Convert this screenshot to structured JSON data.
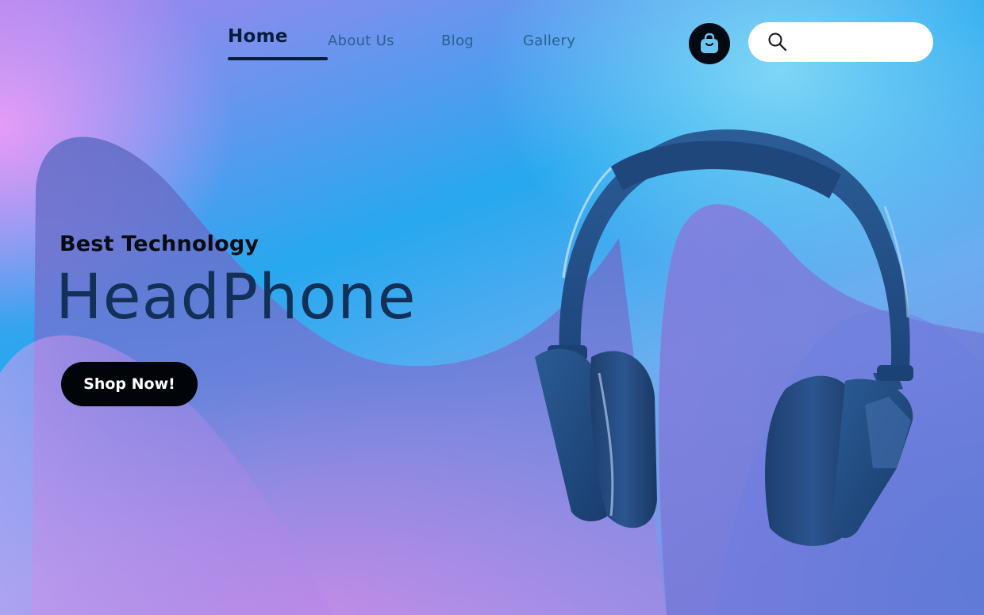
{
  "nav": {
    "items": [
      {
        "label": "Home",
        "active": true
      },
      {
        "label": "About Us",
        "active": false
      },
      {
        "label": "Blog",
        "active": false
      },
      {
        "label": "Gallery",
        "active": false
      }
    ]
  },
  "header": {
    "cart_icon": "shopping-bag-icon",
    "search": {
      "icon": "search-icon",
      "value": "",
      "placeholder": ""
    }
  },
  "hero": {
    "tagline": "Best Technology",
    "title": "HeadPhone",
    "cta_label": "Shop Now!",
    "product_image": "headphones"
  },
  "colors": {
    "primary_dark": "#020a14",
    "title_navy": "#123058",
    "nav_inactive": "#2d5f8f",
    "bg_blue": "#27a8ef",
    "bg_pink": "#e59cf7",
    "product_blue": "#1f4d86"
  }
}
